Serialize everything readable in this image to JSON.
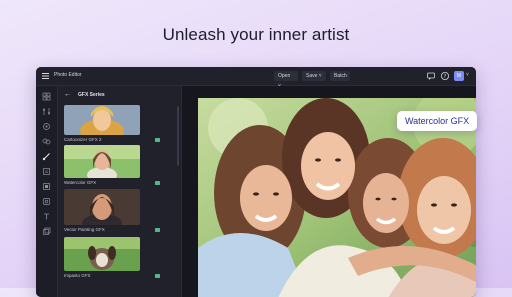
{
  "headline": "Unleash your inner artist",
  "app": {
    "title": "Photo Editor",
    "menu": {
      "open_label": "Open",
      "save_label": "Save",
      "batch_label": "Batch"
    },
    "avatar_initial": "M"
  },
  "rail_icons": [
    "grid-icon",
    "adjust-icon",
    "filter-icon",
    "effects-icon",
    "gfx-icon",
    "layers-icon",
    "crop-icon",
    "frame-icon",
    "text-icon",
    "stack-icon"
  ],
  "panel": {
    "title": "GFX Series",
    "items": [
      {
        "label": "Cartoonizer GFX 2"
      },
      {
        "label": "Watercolor GFX"
      },
      {
        "label": "Vector Painting GFX"
      },
      {
        "label": "Impasto GFX"
      }
    ]
  },
  "callout": "Watercolor GFX",
  "colors": {
    "accent": "#7b8cf5",
    "badge": "#4fb98a",
    "callout_text": "#2a2f8f"
  }
}
